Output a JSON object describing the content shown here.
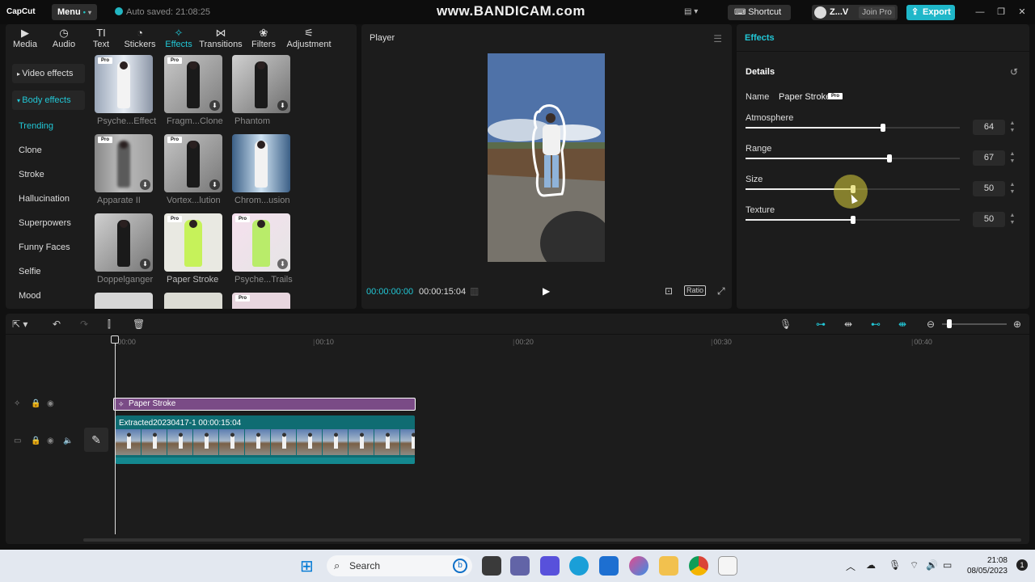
{
  "titlebar": {
    "logo": "CapCut",
    "menu_label": "Menu",
    "autosave": "Auto saved: 21:08:25",
    "watermark": "www.BANDICAM.com",
    "shortcut_label": "Shortcut",
    "user_name": "Z...V",
    "join_pro_label": "Join Pro",
    "export_label": "Export"
  },
  "left_tabs": [
    {
      "label": "Media",
      "icon": "media-icon"
    },
    {
      "label": "Audio",
      "icon": "audio-icon"
    },
    {
      "label": "Text",
      "icon": "text-icon"
    },
    {
      "label": "Stickers",
      "icon": "stickers-icon"
    },
    {
      "label": "Effects",
      "icon": "effects-icon",
      "active": true
    },
    {
      "label": "Transitions",
      "icon": "transitions-icon"
    },
    {
      "label": "Filters",
      "icon": "filters-icon"
    },
    {
      "label": "Adjustment",
      "icon": "adjustment-icon"
    }
  ],
  "sidebar": {
    "groups": [
      {
        "label": "Video effects",
        "expanded": false
      },
      {
        "label": "Body effects",
        "expanded": true
      }
    ],
    "categories": [
      {
        "label": "Trending",
        "active": true
      },
      {
        "label": "Clone"
      },
      {
        "label": "Stroke"
      },
      {
        "label": "Hallucination"
      },
      {
        "label": "Superpowers"
      },
      {
        "label": "Funny Faces"
      },
      {
        "label": "Selfie"
      },
      {
        "label": "Mood"
      }
    ]
  },
  "effects_grid": [
    {
      "label": "Psyche...Effect",
      "pro": true,
      "download": false
    },
    {
      "label": "Fragm...Clone",
      "pro": true,
      "download": true
    },
    {
      "label": "Phantom",
      "pro": false,
      "download": true
    },
    {
      "label": "Apparate II",
      "pro": true,
      "download": true
    },
    {
      "label": "Vortex...lution",
      "pro": true,
      "download": true
    },
    {
      "label": "Chrom...usion",
      "pro": false,
      "download": false
    },
    {
      "label": "Doppelganger",
      "pro": false,
      "download": true
    },
    {
      "label": "Paper Stroke",
      "pro": true,
      "download": false
    },
    {
      "label": "Psyche...Trails",
      "pro": true,
      "download": true
    }
  ],
  "pro_badge": "Pro",
  "player": {
    "title": "Player",
    "current_time": "00:00:00:00",
    "total_time": "00:00:15:04",
    "ratio_label": "Ratio"
  },
  "effects_panel": {
    "title": "Effects",
    "details_label": "Details",
    "name_key": "Name",
    "name_value": "Paper Stroke",
    "params": [
      {
        "label": "Atmosphere",
        "value": "64",
        "level": 0.64
      },
      {
        "label": "Range",
        "value": "67",
        "level": 0.67
      },
      {
        "label": "Size",
        "value": "50",
        "level": 0.5
      },
      {
        "label": "Texture",
        "value": "50",
        "level": 0.5
      }
    ]
  },
  "timeline": {
    "ticks": [
      "00:00",
      "00:10",
      "00:20",
      "00:30",
      "00:40"
    ],
    "effect_clip_label": "Paper Stroke",
    "video_clip_label": "Extracted20230417-1   00:00:15:04"
  },
  "taskbar": {
    "search_placeholder": "Search",
    "time": "21:08",
    "date": "08/05/2023"
  },
  "colors": {
    "accent": "#22c7d6",
    "effect_clip": "#7a4b86",
    "video_clip": "#0f6c72",
    "export_button": "#1fb7c9"
  }
}
